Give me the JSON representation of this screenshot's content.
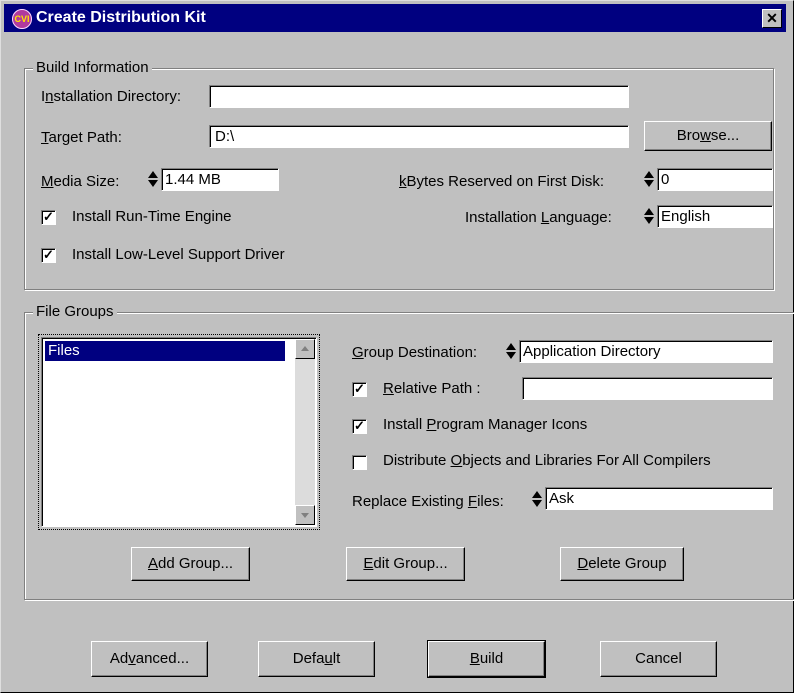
{
  "window": {
    "title": "Create Distribution Kit",
    "close_glyph": "✕",
    "icon_text": "CVI"
  },
  "build_info": {
    "group_label": "Build Information",
    "install_dir_label": "Installation Directory:",
    "install_dir_value": "",
    "target_path_label": "Target Path:",
    "target_path_value": "D:\\",
    "browse_label": "Browse...",
    "media_size_label": "Media Size:",
    "media_size_value": "1.44 MB",
    "kbytes_label": "kBytes Reserved on First Disk:",
    "kbytes_value": "0",
    "install_runtime_label": "Install Run-Time Engine",
    "install_runtime_checked": true,
    "language_label": "Installation Language:",
    "language_value": "English",
    "install_lowlevel_label": "Install Low-Level Support Driver",
    "install_lowlevel_checked": true
  },
  "file_groups": {
    "group_label": "File Groups",
    "items": [
      "Files"
    ],
    "group_destination_label": "Group Destination:",
    "group_destination_value": "Application Directory",
    "relative_path_label": "Relative Path :",
    "relative_path_checked": true,
    "relative_path_value": "",
    "install_pm_icons_label": "Install Program Manager Icons",
    "install_pm_icons_checked": true,
    "distribute_objects_label": "Distribute Objects and Libraries For All Compilers",
    "distribute_objects_checked": false,
    "replace_files_label": "Replace Existing Files:",
    "replace_files_value": "Ask",
    "add_group_label": "Add Group...",
    "edit_group_label": "Edit Group...",
    "delete_group_label": "Delete Group"
  },
  "footer": {
    "advanced_label": "Advanced...",
    "default_label": "Default",
    "build_label": "Build",
    "cancel_label": "Cancel"
  },
  "colors": {
    "titlebar": "#000080",
    "face": "#c0c0c0",
    "selection": "#000080"
  }
}
